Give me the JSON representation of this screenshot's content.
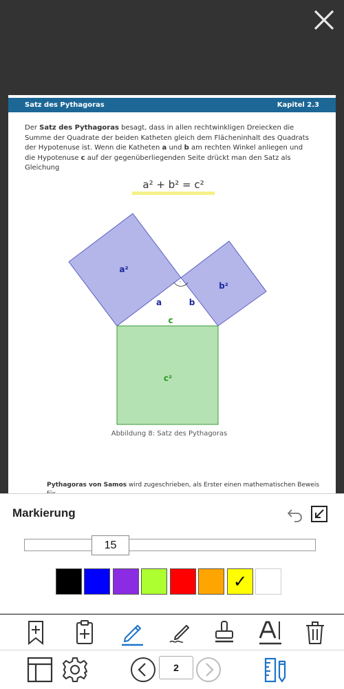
{
  "document": {
    "header_left": "Satz des Pythagoras",
    "header_right": "Kapitel 2.3",
    "intro": {
      "t1": "Der ",
      "b1": "Satz des Pythagoras",
      "t2": " besagt, dass in allen rechtwinkligen Dreiecken die Summe der Quadrate der beiden Katheten gleich dem Flächeninhalt des Quadrats der Hypotenuse ist. Wenn die Katheten ",
      "b2": "a",
      "t3": " und ",
      "b3": "b",
      "t4": " am rechten Winkel anliegen und die Hypotenuse ",
      "b4": "c",
      "t5": " auf der gegenüberliegenden Seite drückt man den Satz als Gleichung"
    },
    "formula": "a² + b² = c²",
    "figure": {
      "label_a2": "a²",
      "label_b2": "b²",
      "label_c2": "c²",
      "label_a": "a",
      "label_b": "b",
      "label_c": "c",
      "right_angle_mark": "·"
    },
    "caption": "Abbildung 8: Satz des Pythagoras",
    "para_bold": "Pythagoras von Samos",
    "para_text": " wird zugeschrieben, als Erster einen mathematischen Beweis für"
  },
  "panel": {
    "title": "Markierung",
    "stroke_width": "15",
    "colors": [
      "#000000",
      "#0000ff",
      "#8b2be2",
      "#adff2f",
      "#ff0000",
      "#ffa500",
      "#ffff00",
      "#ffffff"
    ],
    "selected_color_index": 6,
    "check_glyph": "✓"
  },
  "pager": {
    "page": "2"
  },
  "theme": {
    "accent": "#1a73c8",
    "header_blue": "#1c6796",
    "square_ab_fill": "#b4b6ea",
    "square_c_fill": "#b5e2b2",
    "label_blue": "#1c2a9c",
    "label_green": "#2a9a26"
  }
}
